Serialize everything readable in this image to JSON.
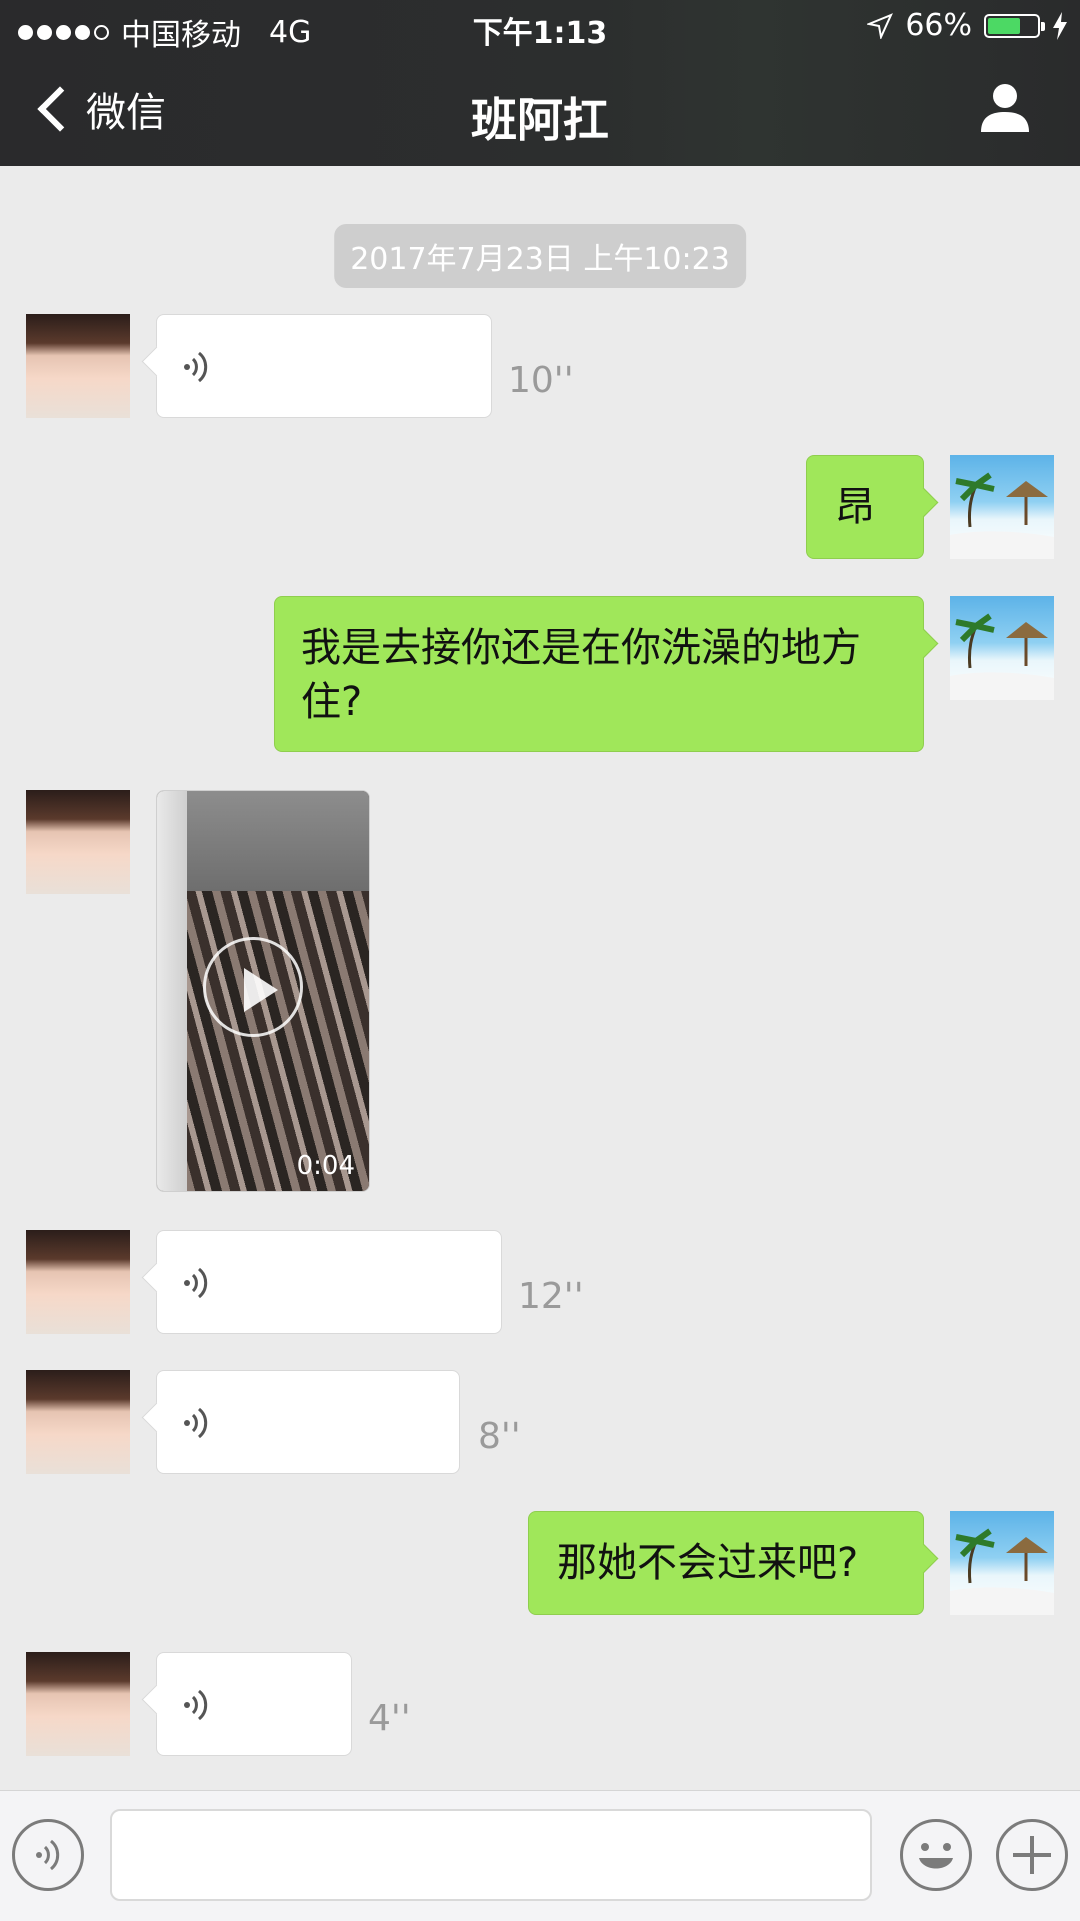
{
  "status_bar": {
    "carrier": "中国移动",
    "network": "4G",
    "time": "下午1:13",
    "battery_percent": "66%",
    "battery_level": 0.66
  },
  "nav": {
    "back_label": "微信",
    "title": "班阿扛"
  },
  "chat": {
    "timestamp": "2017年7月23日 上午10:23",
    "messages": [
      {
        "sender": "her",
        "type": "voice",
        "duration": "10''"
      },
      {
        "sender": "me",
        "type": "text",
        "text": "昂"
      },
      {
        "sender": "me",
        "type": "text",
        "text": "我是去接你还是在你洗澡的地方住?"
      },
      {
        "sender": "her",
        "type": "video",
        "duration": "0:04"
      },
      {
        "sender": "her",
        "type": "voice",
        "duration": "12''"
      },
      {
        "sender": "her",
        "type": "voice",
        "duration": "8''"
      },
      {
        "sender": "me",
        "type": "text",
        "text": "那她不会过来吧?"
      },
      {
        "sender": "her",
        "type": "voice",
        "duration": "4''"
      }
    ]
  },
  "input_bar": {
    "input_value": ""
  },
  "colors": {
    "header_bg": "#2c2e2e",
    "chat_bg": "#ebebeb",
    "my_bubble": "#a0e75a",
    "their_bubble": "#ffffff",
    "battery_fill": "#4cd964"
  }
}
